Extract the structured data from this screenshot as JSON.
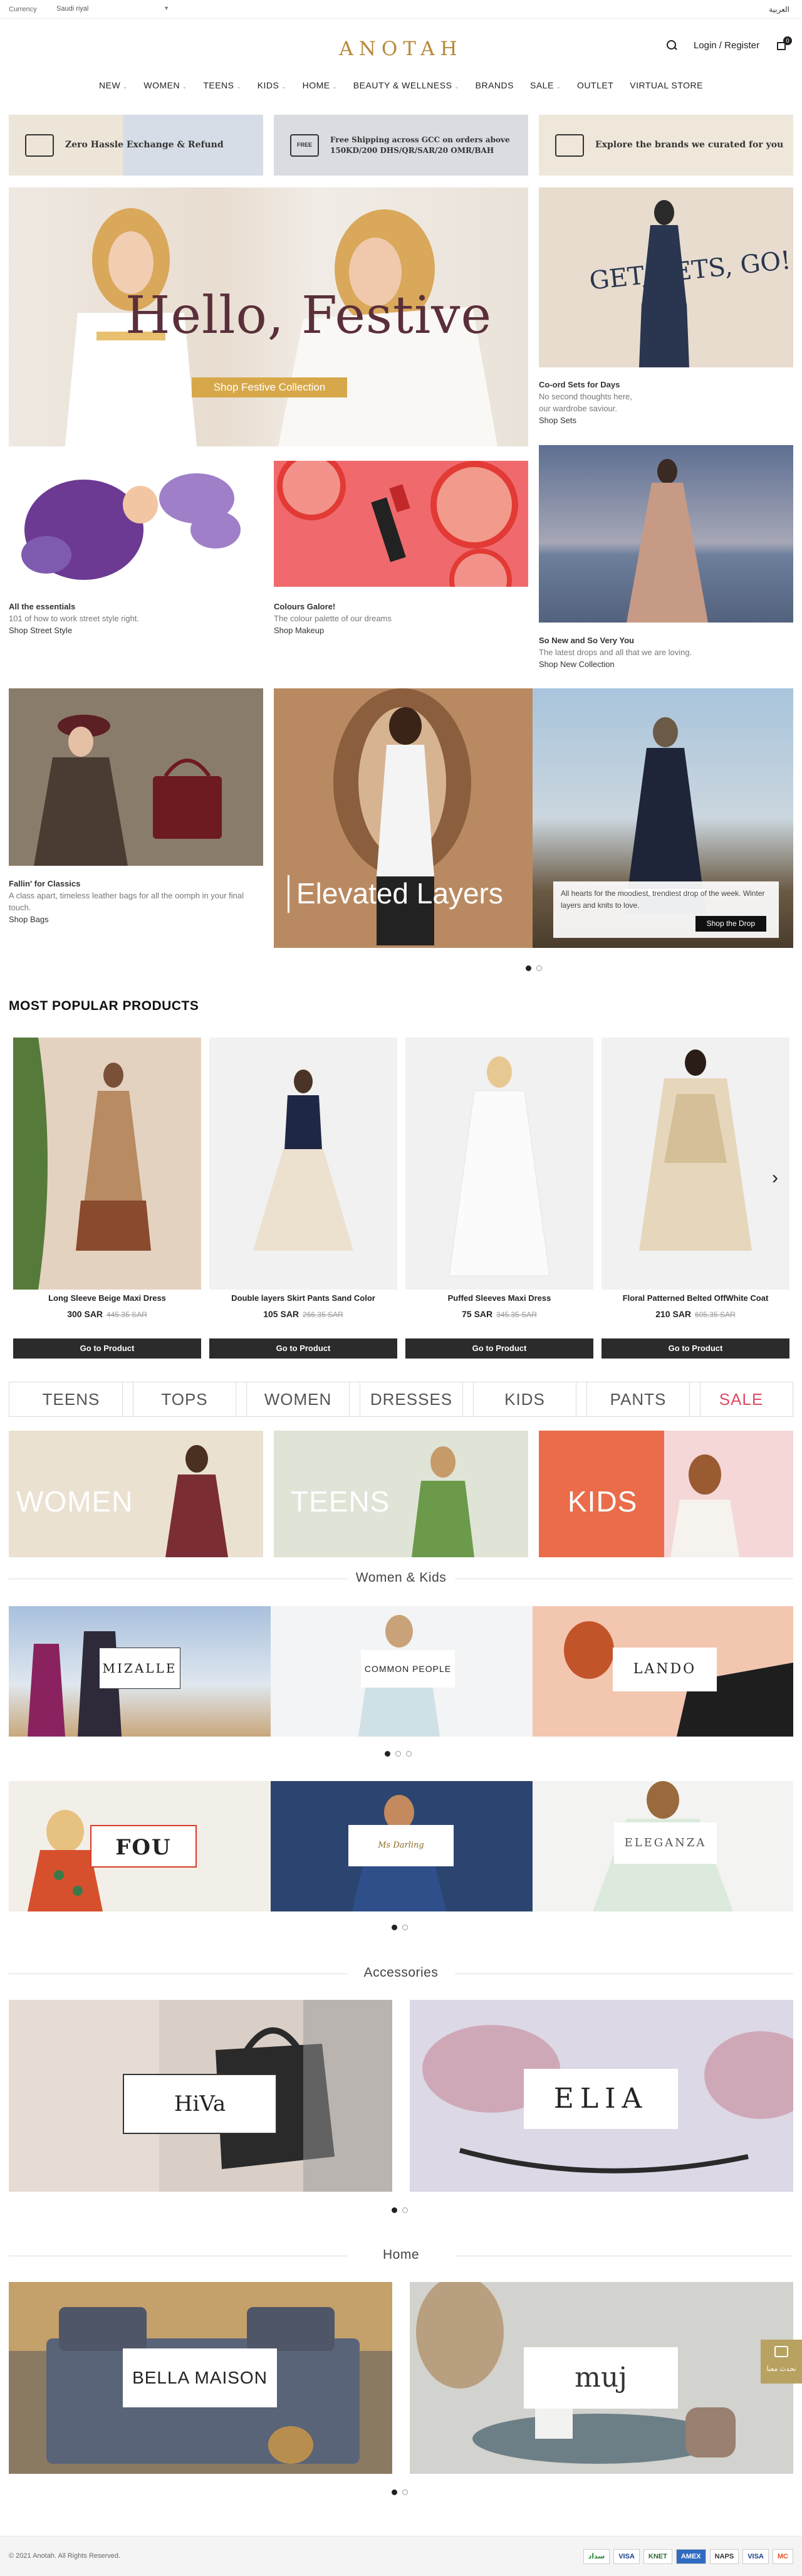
{
  "topbar": {
    "currency_label": "Currency",
    "currency_value": "Saudi riyal",
    "language": "العربية"
  },
  "header": {
    "logo": "ANOTAH",
    "login": "Login / Register",
    "cart_count": "0"
  },
  "nav": [
    {
      "label": "NEW",
      "dd": "⌄"
    },
    {
      "label": "WOMEN",
      "dd": "⌄"
    },
    {
      "label": "TEENS",
      "dd": "⌄"
    },
    {
      "label": "KIDS",
      "dd": "⌄"
    },
    {
      "label": "HOME",
      "dd": "⌄"
    },
    {
      "label": "BEAUTY & WELLNESS",
      "dd": "⌄"
    },
    {
      "label": "BRANDS",
      "dd": ""
    },
    {
      "label": "SALE",
      "dd": "⌄"
    },
    {
      "label": "OUTLET",
      "dd": ""
    },
    {
      "label": "VIRTUAL STORE",
      "dd": ""
    }
  ],
  "promos": [
    {
      "text": "Zero Hassle Exchange & Refund"
    },
    {
      "text": "Free Shipping across GCC on orders above 150KD/200 DHS/QR/SAR/20 OMR/BAH",
      "tag": "FREE"
    },
    {
      "text": "Explore the brands we curated for you"
    }
  ],
  "hero": {
    "headline": "Hello, Festive",
    "button": "Shop Festive Collection"
  },
  "sets": {
    "overlay": "GET, SETS, GO!",
    "title": "Co-ord Sets for Days",
    "lines": [
      "No second thoughts here,",
      "our wardrobe saviour."
    ],
    "link": "Shop Sets"
  },
  "essentials": {
    "title": "All the essentials",
    "desc": "101 of how to work street style right.",
    "link": "Shop Street Style"
  },
  "colours": {
    "title": "Colours Galore!",
    "desc": "The colour palette of our dreams",
    "link": "Shop Makeup"
  },
  "newdrops": {
    "title": "So New and So Very You",
    "desc": "The latest drops and all that we are loving.",
    "link": "Shop New Collection"
  },
  "classics": {
    "title": "Fallin' for Classics",
    "desc": "A class apart, timeless leather bags for all the oomph in your final touch.",
    "link": "Shop Bags"
  },
  "layers": {
    "headline": "Elevated Layers",
    "desc": "All hearts for the moodiest, trendiest drop of the week. Winter layers and knits to love.",
    "button": "Shop the Drop"
  },
  "popular": {
    "title": "MOST POPULAR PRODUCTS",
    "products": [
      {
        "name": "Long Sleeve Beige Maxi Dress",
        "price": "300 SAR",
        "old": "445.35 SAR",
        "button": "Go to Product"
      },
      {
        "name": "Double layers Skirt Pants Sand Color",
        "price": "105 SAR",
        "old": "266.35 SAR",
        "button": "Go to Product"
      },
      {
        "name": "Puffed Sleeves Maxi Dress",
        "price": "75 SAR",
        "old": "345.35 SAR",
        "button": "Go to Product"
      },
      {
        "name": "Floral Patterned Belted OffWhite Coat",
        "price": "210 SAR",
        "old": "605.35 SAR",
        "button": "Go to Product"
      }
    ]
  },
  "chips": [
    "TEENS",
    "TOPS",
    "WOMEN",
    "DRESSES",
    "KIDS",
    "PANTS",
    "SALE"
  ],
  "categories": [
    "WOMEN",
    "TEENS",
    "KIDS"
  ],
  "women_kids": {
    "title": "Women & Kids",
    "brands": [
      "MIZALLE",
      "COMMON PEOPLE",
      "LANDO",
      "FOU",
      "Ms Darling",
      "ELEGANZA"
    ]
  },
  "accessories": {
    "title": "Accessories",
    "brands": [
      "HiVa",
      "ELIA"
    ]
  },
  "home": {
    "title": "Home",
    "brands": [
      "BELLA MAISON",
      "muj"
    ]
  },
  "chat": "تحدث معنا",
  "footer": {
    "copyright": "© 2021 Anotah. All Rights Reserved.",
    "payments": [
      "سداد",
      "VISA",
      "KNET",
      "AMEX",
      "NAPS",
      "VISA",
      "MC"
    ]
  }
}
